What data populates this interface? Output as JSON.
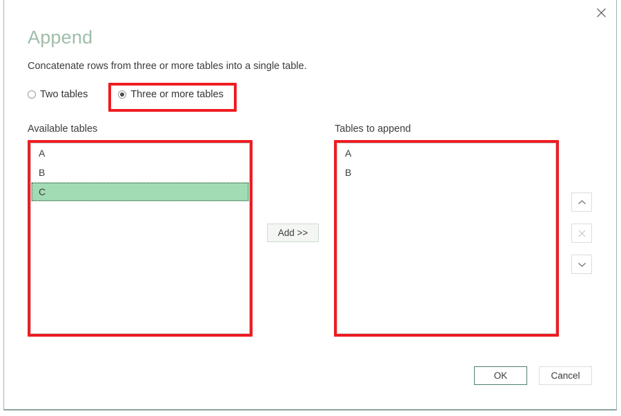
{
  "dialog": {
    "title": "Append",
    "subtitle": "Concatenate rows from three or more tables into a single table.",
    "close_icon": "close-icon",
    "accent_color": "#9fbda9",
    "annotation_color": "#ee1c22",
    "selection_color": "#a2dcb5"
  },
  "mode_options": [
    {
      "label": "Two tables",
      "selected": false
    },
    {
      "label": "Three or more tables",
      "selected": true
    }
  ],
  "available": {
    "label": "Available tables",
    "items": [
      {
        "name": "A",
        "selected": false
      },
      {
        "name": "B",
        "selected": false
      },
      {
        "name": "C",
        "selected": true
      }
    ]
  },
  "append": {
    "label": "Tables to append",
    "items": [
      {
        "name": "A",
        "selected": false
      },
      {
        "name": "B",
        "selected": false
      }
    ]
  },
  "transfer": {
    "add_label": "Add >>"
  },
  "side_buttons": [
    {
      "icon": "chevron-up-icon",
      "enabled": true
    },
    {
      "icon": "close-x-icon",
      "enabled": false
    },
    {
      "icon": "chevron-down-icon",
      "enabled": true
    }
  ],
  "footer": {
    "ok_label": "OK",
    "cancel_label": "Cancel"
  }
}
